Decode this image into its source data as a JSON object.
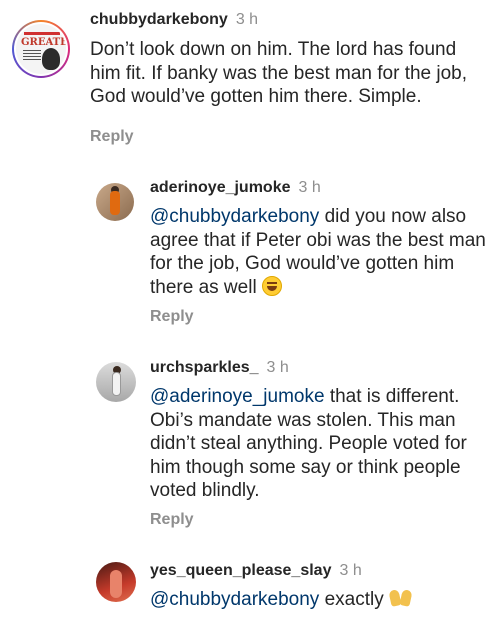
{
  "comments": [
    {
      "username": "chubbydarkebony",
      "time": "3 h",
      "text": "Don’t look down on him. The lord has found him fit. If banky was the best man for the job, God would’ve gotten him there. Simple.",
      "reply_label": "Reply",
      "avatar_text": {
        "top": "POWER OF THE PE...",
        "big": "GREATEr",
        "small": "THAN THE PEOPLE IN POWER"
      }
    },
    {
      "username": "aderinoye_jumoke",
      "time": "3 h",
      "mention": "@chubbydarkebony",
      "text": " did you now also agree that if Peter obi was the best man for the job, God would’ve gotten him there as well ",
      "emoji": "grinning-squinting-face",
      "reply_label": "Reply"
    },
    {
      "username": "urchsparkles_",
      "time": "3 h",
      "mention": "@aderinoye_jumoke",
      "text": " that is different. Obi’s mandate was stolen. This man didn’t steal anything. People voted for him though some say or think people voted blindly.",
      "reply_label": "Reply"
    },
    {
      "username": "yes_queen_please_slay",
      "time": "3 h",
      "mention": "@chubbydarkebony",
      "text": " exactly ",
      "emoji": "raising-hands"
    }
  ],
  "colors": {
    "mention": "#00376b",
    "meta": "#8e8e8e",
    "text": "#262626"
  }
}
